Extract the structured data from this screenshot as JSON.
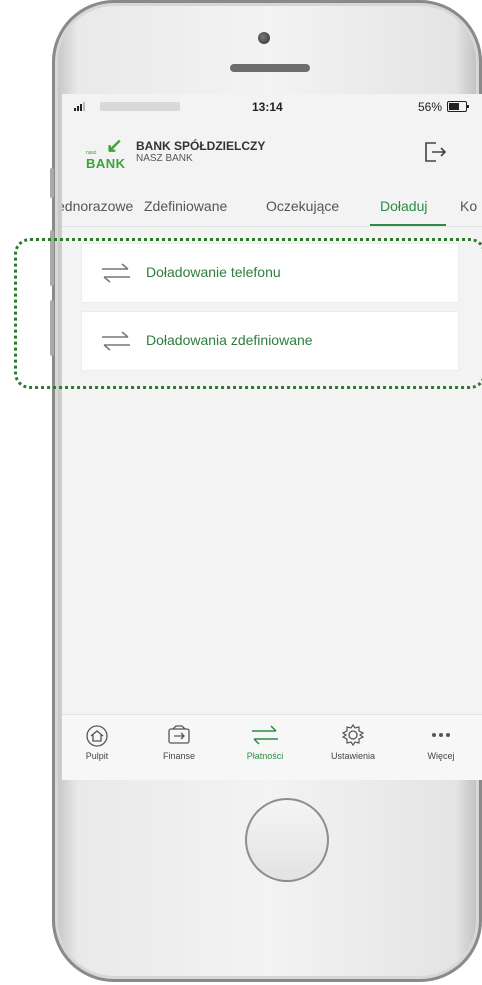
{
  "status_bar": {
    "time": "13:14",
    "battery": "56%"
  },
  "header": {
    "bank_name": "BANK SPÓŁDZIELCZY",
    "bank_subname": "NASZ BANK",
    "logo_small": "nasz",
    "logo_big": "BANK"
  },
  "tabs": [
    {
      "label": "Jednorazowe"
    },
    {
      "label": "Zdefiniowane"
    },
    {
      "label": "Oczekujące"
    },
    {
      "label": "Doładuj"
    },
    {
      "label": "Ko"
    }
  ],
  "active_tab": "Doładuj",
  "items": [
    {
      "label": "Doładowanie telefonu"
    },
    {
      "label": "Doładowania zdefiniowane"
    }
  ],
  "bottom_nav": [
    {
      "label": "Pulpit",
      "icon": "home-icon"
    },
    {
      "label": "Finanse",
      "icon": "wallet-icon"
    },
    {
      "label": "Płatności",
      "icon": "transfer-icon",
      "active": true
    },
    {
      "label": "Ustawienia",
      "icon": "gear-icon"
    },
    {
      "label": "Więcej",
      "icon": "more-icon"
    }
  ],
  "colors": {
    "accent": "#2e8b45",
    "highlight_border": "#2d7a2d"
  }
}
